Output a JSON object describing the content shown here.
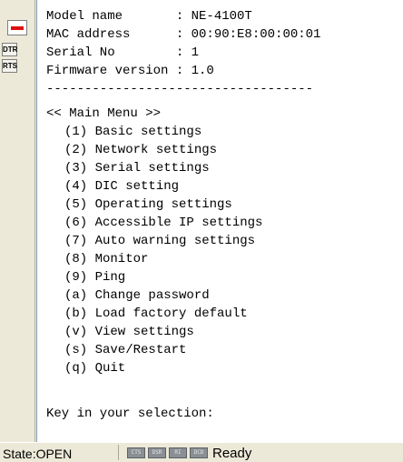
{
  "terminal": {
    "info_lines": [
      "Model name       : NE-4100T",
      "MAC address      : 00:90:E8:00:00:01",
      "Serial No        : 1",
      "Firmware version : 1.0"
    ],
    "separator": "-----------------------------------",
    "menu_title": "<< Main Menu >>",
    "menu_items": [
      "(1) Basic settings",
      "(2) Network settings",
      "(3) Serial settings",
      "(4) DIC setting",
      "(5) Operating settings",
      "(6) Accessible IP settings",
      "(7) Auto warning settings",
      "(8) Monitor",
      "(9) Ping",
      "(a) Change password",
      "(b) Load factory default",
      "(v) View settings",
      "(s) Save/Restart",
      "(q) Quit"
    ],
    "prompt": "Key in your selection:"
  },
  "sidebar": {
    "indicator_color": "#e01010",
    "dtr_label": "DTR",
    "rts_label": "RTS"
  },
  "status_bar": {
    "state": "State:OPEN",
    "leds": [
      "CTS",
      "DSR",
      "RI",
      "DCD"
    ],
    "ready": "Ready"
  }
}
